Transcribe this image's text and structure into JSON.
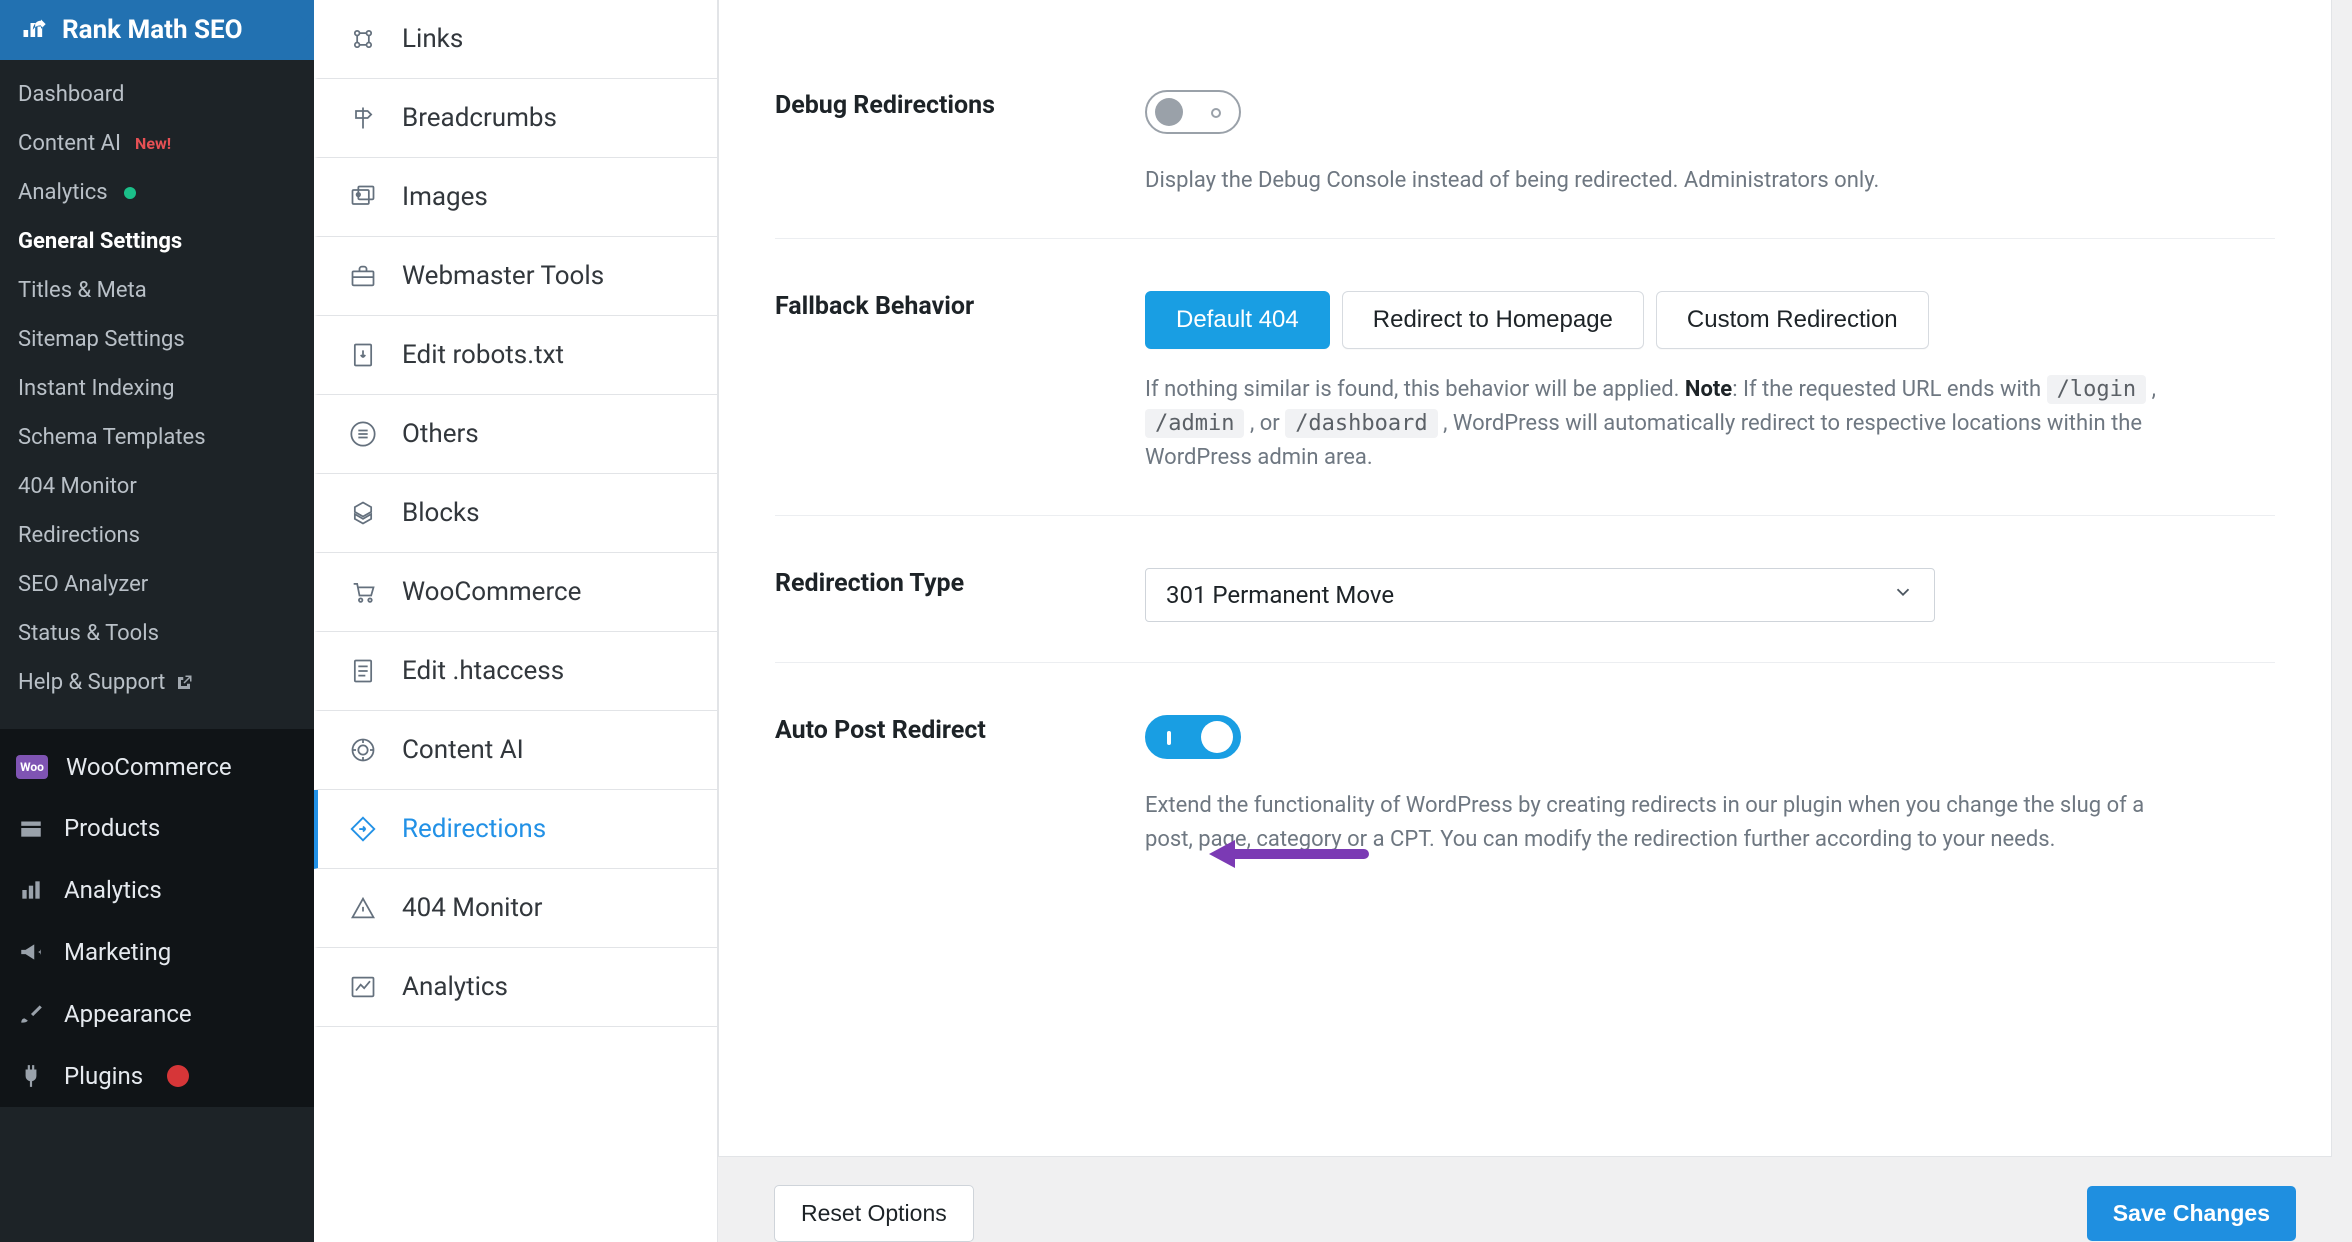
{
  "wp": {
    "brand": "Rank Math SEO",
    "submenu": [
      {
        "label": "Dashboard"
      },
      {
        "label": "Content AI",
        "new": true
      },
      {
        "label": "Analytics",
        "dot": true
      },
      {
        "label": "General Settings",
        "bold": true
      },
      {
        "label": "Titles & Meta"
      },
      {
        "label": "Sitemap Settings"
      },
      {
        "label": "Instant Indexing"
      },
      {
        "label": "Schema Templates"
      },
      {
        "label": "404 Monitor"
      },
      {
        "label": "Redirections"
      },
      {
        "label": "SEO Analyzer"
      },
      {
        "label": "Status & Tools"
      },
      {
        "label": "Help & Support",
        "external": true
      }
    ],
    "main": [
      {
        "label": "WooCommerce",
        "icon": "woo"
      },
      {
        "label": "Products",
        "icon": "products"
      },
      {
        "label": "Analytics",
        "icon": "analytics"
      },
      {
        "label": "Marketing",
        "icon": "marketing"
      },
      {
        "label": "Appearance",
        "icon": "appearance"
      },
      {
        "label": "Plugins",
        "icon": "plugins",
        "count": true
      }
    ],
    "new_badge": "New!"
  },
  "settings_tabs": [
    {
      "label": "Links",
      "icon": "links"
    },
    {
      "label": "Breadcrumbs",
      "icon": "breadcrumbs"
    },
    {
      "label": "Images",
      "icon": "images"
    },
    {
      "label": "Webmaster Tools",
      "icon": "webmaster"
    },
    {
      "label": "Edit robots.txt",
      "icon": "robots"
    },
    {
      "label": "Others",
      "icon": "others"
    },
    {
      "label": "Blocks",
      "icon": "blocks"
    },
    {
      "label": "WooCommerce",
      "icon": "cart"
    },
    {
      "label": "Edit .htaccess",
      "icon": "htaccess"
    },
    {
      "label": "Content AI",
      "icon": "ai"
    },
    {
      "label": "Redirections",
      "icon": "redirections",
      "active": true
    },
    {
      "label": "404 Monitor",
      "icon": "warning"
    },
    {
      "label": "Analytics",
      "icon": "chart"
    }
  ],
  "redirections": {
    "debug": {
      "label": "Debug Redirections",
      "on": false,
      "desc": "Display the Debug Console instead of being redirected. Administrators only."
    },
    "fallback": {
      "label": "Fallback Behavior",
      "options": [
        "Default 404",
        "Redirect to Homepage",
        "Custom Redirection"
      ],
      "active": 0,
      "desc_before": "If nothing similar is found, this behavior will be applied. ",
      "note_label": "Note",
      "desc_mid": ": If the requested URL ends with ",
      "code1": "/login",
      "sep1": " , ",
      "code2": "/admin",
      "sep2": " , or ",
      "code3": "/dashboard",
      "desc_after": " , WordPress will automatically redirect to respective locations within the WordPress admin area."
    },
    "type": {
      "label": "Redirection Type",
      "value": "301 Permanent Move"
    },
    "auto": {
      "label": "Auto Post Redirect",
      "on": true,
      "desc": "Extend the functionality of WordPress by creating redirects in our plugin when you change the slug of a post, page, category or a CPT. You can modify the redirection further according to your needs."
    }
  },
  "buttons": {
    "reset": "Reset Options",
    "save": "Save Changes"
  }
}
